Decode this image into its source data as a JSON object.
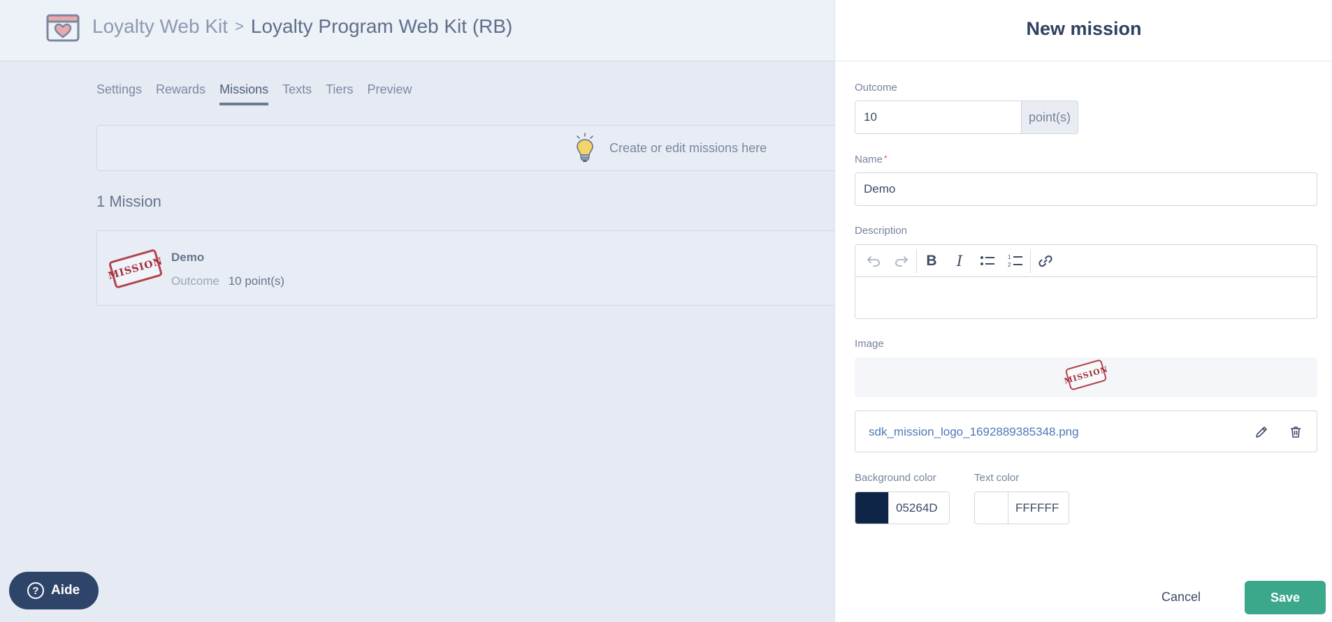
{
  "header": {
    "breadcrumb_parent": "Loyalty Web Kit",
    "breadcrumb_separator": ">",
    "breadcrumb_current": "Loyalty Program Web Kit (RB)"
  },
  "tabs": [
    {
      "label": "Settings",
      "active": false
    },
    {
      "label": "Rewards",
      "active": false
    },
    {
      "label": "Missions",
      "active": true
    },
    {
      "label": "Texts",
      "active": false
    },
    {
      "label": "Tiers",
      "active": false
    },
    {
      "label": "Preview",
      "active": false
    }
  ],
  "tip": {
    "text": "Create or edit missions here",
    "icon": "lightbulb-icon"
  },
  "missions": {
    "count_label": "1 Mission",
    "items": [
      {
        "name": "Demo",
        "outcome_label": "Outcome",
        "outcome_value": "10 point(s)",
        "image_text": "MISSION"
      }
    ]
  },
  "help": {
    "label": "Aide",
    "icon_glyph": "?"
  },
  "panel": {
    "title": "New mission",
    "outcome": {
      "label": "Outcome",
      "value": "10",
      "unit": "point(s)"
    },
    "name": {
      "label": "Name",
      "required_marker": "*",
      "value": "Demo"
    },
    "description": {
      "label": "Description",
      "toolbar": [
        "undo-icon",
        "redo-icon",
        "bold-icon",
        "italic-icon",
        "bullet-list-icon",
        "numbered-list-icon",
        "link-icon"
      ],
      "bold_glyph": "B",
      "italic_glyph": "I"
    },
    "image": {
      "label": "Image",
      "stamp_text": "MISSION",
      "file_name": "sdk_mission_logo_1692889385348.png"
    },
    "background_color": {
      "label": "Background color",
      "value": "05264D",
      "swatch": "#0f2545"
    },
    "text_color": {
      "label": "Text color",
      "value": "FFFFFF",
      "swatch": "#ffffff"
    },
    "cancel_label": "Cancel",
    "save_label": "Save"
  },
  "colors": {
    "accent_green": "#3ba88b",
    "help_button": "#2e4469",
    "link_blue": "#4e79b6"
  }
}
